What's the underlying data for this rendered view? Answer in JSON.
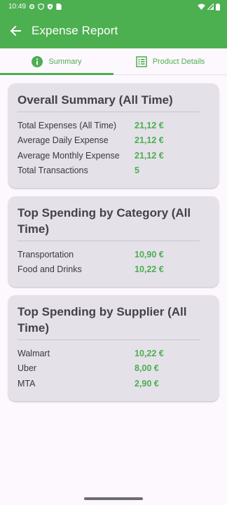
{
  "status_bar": {
    "time": "10:49",
    "left_icons": [
      "settings-icon",
      "shield-icon",
      "shield-check-icon",
      "sim-icon"
    ],
    "right_icons": [
      "wifi-icon",
      "signal-icon",
      "battery-icon"
    ]
  },
  "app_bar": {
    "title": "Expense Report",
    "back_icon": "arrow-left-icon",
    "color": "#4caf50"
  },
  "tabs": [
    {
      "label": "Summary",
      "icon": "info-icon",
      "selected": true
    },
    {
      "label": "Product Details",
      "icon": "list-icon",
      "selected": false
    }
  ],
  "cards": {
    "overall": {
      "title": "Overall Summary (All Time)",
      "rows": [
        {
          "label": "Total Expenses (All Time)",
          "value": "21,12 €"
        },
        {
          "label": "Average Daily Expense",
          "value": "21,12 €"
        },
        {
          "label": "Average Monthly Expense",
          "value": "21,12 €"
        },
        {
          "label": "Total Transactions",
          "value": "5"
        }
      ]
    },
    "category": {
      "title": "Top Spending by Category (All Time)",
      "rows": [
        {
          "label": "Transportation",
          "value": "10,90 €"
        },
        {
          "label": "Food and Drinks",
          "value": "10,22 €"
        }
      ]
    },
    "supplier": {
      "title": "Top Spending by Supplier (All Time)",
      "rows": [
        {
          "label": "Walmart",
          "value": "10,22 €"
        },
        {
          "label": "Uber",
          "value": "8,00 €"
        },
        {
          "label": "MTA",
          "value": "2,90 €"
        }
      ]
    }
  }
}
